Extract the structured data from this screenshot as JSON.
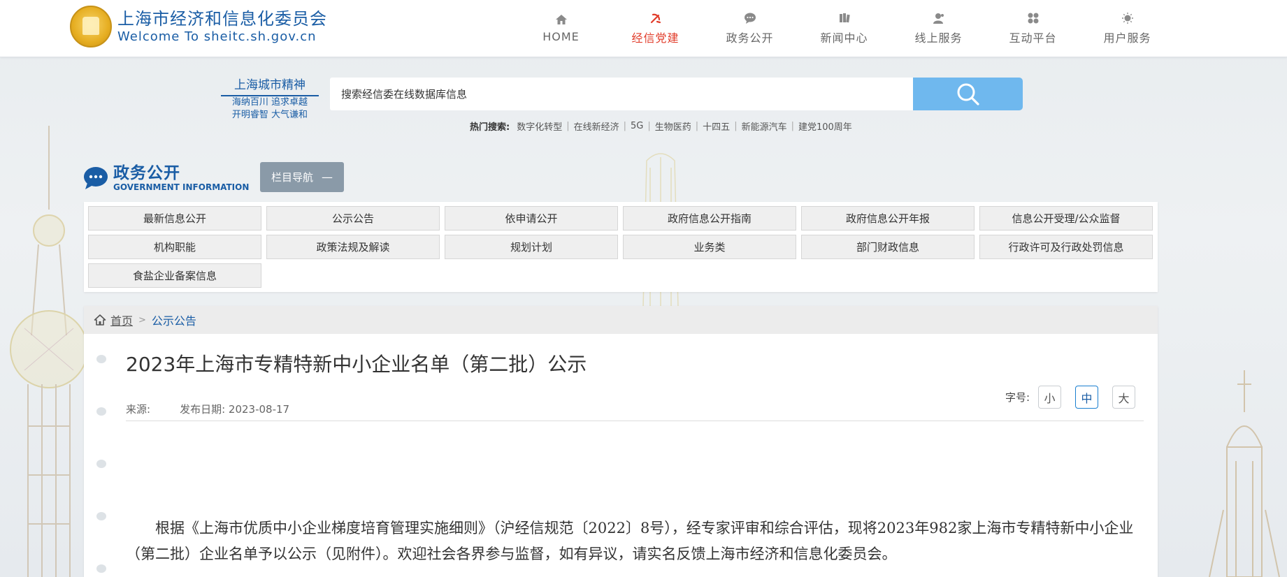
{
  "header": {
    "logo_cn": "上海市经济和信息化委员会",
    "logo_en": "Welcome To sheitc.sh.gov.cn",
    "nav": [
      {
        "label": "HOME",
        "icon": "home-icon"
      },
      {
        "label": "经信党建",
        "icon": "party-emblem-icon",
        "active": true
      },
      {
        "label": "政务公开",
        "icon": "chat-icon"
      },
      {
        "label": "新闻中心",
        "icon": "news-icon"
      },
      {
        "label": "线上服务",
        "icon": "user-service-icon"
      },
      {
        "label": "互动平台",
        "icon": "interaction-icon"
      },
      {
        "label": "用户服务",
        "icon": "user-icon"
      }
    ]
  },
  "spirit": {
    "title": "上海城市精神",
    "line1": "海纳百川 追求卓越",
    "line2": "开明睿智 大气谦和"
  },
  "search": {
    "placeholder": "搜索经信委在线数据库信息",
    "hot_label": "热门搜索:",
    "hot": [
      "数字化转型",
      "在线新经济",
      "5G",
      "生物医药",
      "十四五",
      "新能源汽车",
      "建党100周年"
    ]
  },
  "section": {
    "title": "政务公开",
    "subtitle": "GOVERNMENT INFORMATION",
    "nav_button": "栏目导航",
    "nav_button_symbol": "—",
    "grid": [
      "最新信息公开",
      "公示公告",
      "依申请公开",
      "政府信息公开指南",
      "政府信息公开年报",
      "信息公开受理/公众监督",
      "机构职能",
      "政策法规及解读",
      "规划计划",
      "业务类",
      "部门财政信息",
      "行政许可及行政处罚信息",
      "食盐企业备案信息"
    ]
  },
  "breadcrumb": {
    "home": "首页",
    "sep": ">",
    "current": "公示公告"
  },
  "article": {
    "title": "2023年上海市专精特新中小企业名单（第二批）公示",
    "source_label": "来源:",
    "date_label": "发布日期:",
    "date": "2023-08-17",
    "fontsize_label": "字号:",
    "fontsize_options": [
      "小",
      "中",
      "大"
    ],
    "body": "根据《上海市优质中小企业梯度培育管理实施细则》（沪经信规范〔2022〕8号），经专家评审和综合评估，现将2023年982家上海市专精特新中小企业（第二批）企业名单予以公示（见附件）。欢迎社会各界参与监督，如有异议，请实名反馈上海市经济和信息化委员会。"
  },
  "colors": {
    "brand_blue": "#1a5da5",
    "active_red": "#e13c2a",
    "search_button": "#6fb8ee"
  }
}
